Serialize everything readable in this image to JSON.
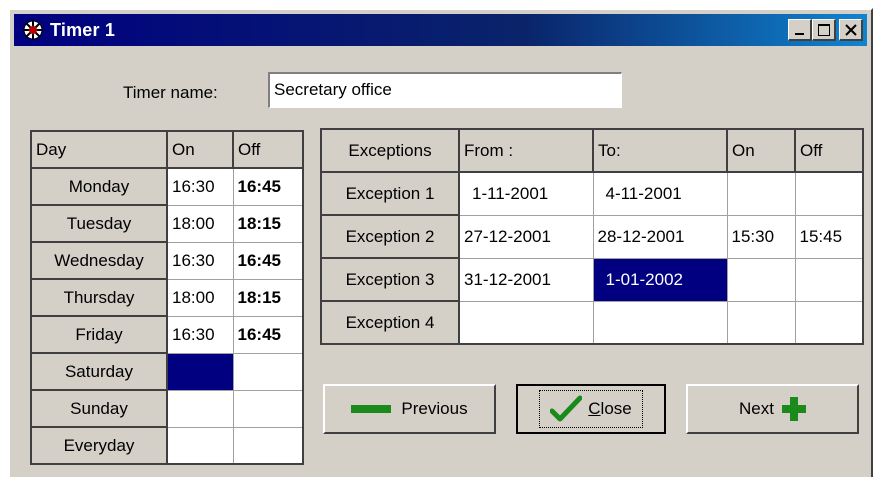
{
  "window": {
    "title": "Timer 1",
    "minimize_label": "_",
    "maximize_label": "□",
    "close_label": "X"
  },
  "form": {
    "timer_name_label": "Timer name:",
    "timer_name_value": "Secretary office"
  },
  "days_table": {
    "headers": [
      "Day",
      "On",
      "Off"
    ],
    "rows": [
      {
        "day": "Monday",
        "on": "16:30",
        "off": "16:45"
      },
      {
        "day": "Tuesday",
        "on": "18:00",
        "off": "18:15"
      },
      {
        "day": "Wednesday",
        "on": "16:30",
        "off": "16:45"
      },
      {
        "day": "Thursday",
        "on": "18:00",
        "off": "18:15"
      },
      {
        "day": "Friday",
        "on": "16:30",
        "off": "16:45"
      },
      {
        "day": "Saturday",
        "on": "",
        "off": ""
      },
      {
        "day": "Sunday",
        "on": "",
        "off": ""
      },
      {
        "day": "Everyday",
        "on": "",
        "off": ""
      }
    ]
  },
  "exceptions_table": {
    "headers": [
      "Exceptions",
      "From :",
      "To:",
      "On",
      "Off"
    ],
    "rows": [
      {
        "name": "Exception 1",
        "from": "1-11-2001",
        "to": "4-11-2001",
        "on": "",
        "off": ""
      },
      {
        "name": "Exception 2",
        "from": "27-12-2001",
        "to": "28-12-2001",
        "on": "15:30",
        "off": "15:45"
      },
      {
        "name": "Exception 3",
        "from": "31-12-2001",
        "to": "1-01-2002",
        "on": "",
        "off": ""
      },
      {
        "name": "Exception 4",
        "from": "",
        "to": "",
        "on": "",
        "off": ""
      }
    ]
  },
  "buttons": {
    "previous": "Previous",
    "close_underlined": "C",
    "close_rest": "lose",
    "next": "Next"
  },
  "colors": {
    "title_bar": "#000080",
    "selection": "#000080",
    "accent_green": "#1a8a1a",
    "face": "#d4d0c8"
  }
}
